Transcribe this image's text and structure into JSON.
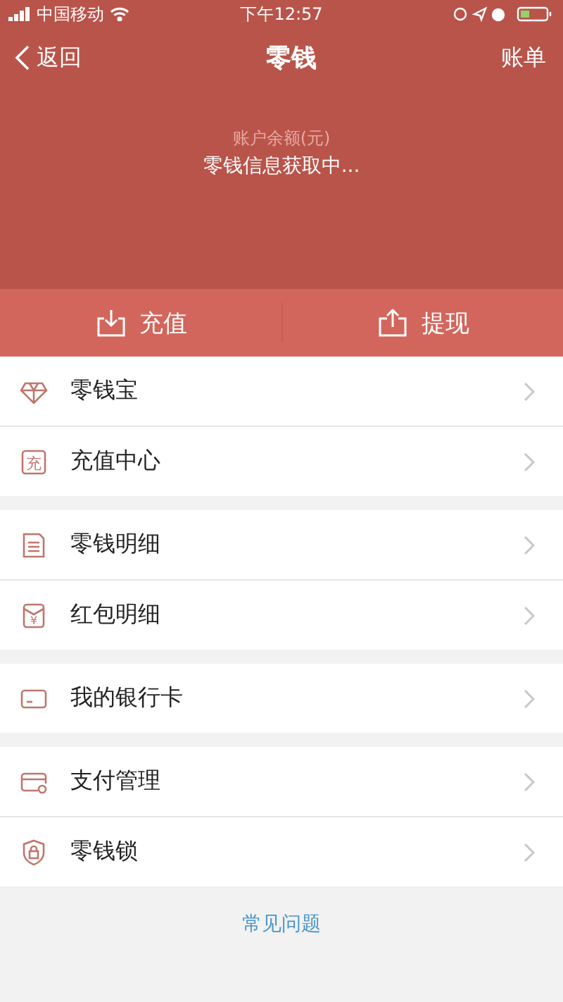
{
  "status_bar": {
    "carrier": "中国移动",
    "time": "下午12:57"
  },
  "nav": {
    "back": "返回",
    "title": "零钱",
    "action": "账单"
  },
  "balance": {
    "label": "账户余额(元)",
    "value": "零钱信息获取中..."
  },
  "actions": [
    {
      "kind": "deposit",
      "label": "充值"
    },
    {
      "kind": "withdraw",
      "label": "提现"
    }
  ],
  "groups": [
    {
      "items": [
        {
          "kind": "diamond",
          "label": "零钱宝"
        },
        {
          "kind": "badge",
          "icon_text": "充",
          "label": "充值中心"
        }
      ]
    },
    {
      "items": [
        {
          "kind": "document",
          "label": "零钱明细"
        },
        {
          "kind": "envelope",
          "icon_text": "¥",
          "label": "红包明细"
        }
      ]
    },
    {
      "items": [
        {
          "kind": "card",
          "label": "我的银行卡"
        }
      ]
    },
    {
      "items": [
        {
          "kind": "payment",
          "label": "支付管理"
        },
        {
          "kind": "shield",
          "label": "零钱锁"
        }
      ]
    }
  ],
  "faq_link": "常见问题"
}
